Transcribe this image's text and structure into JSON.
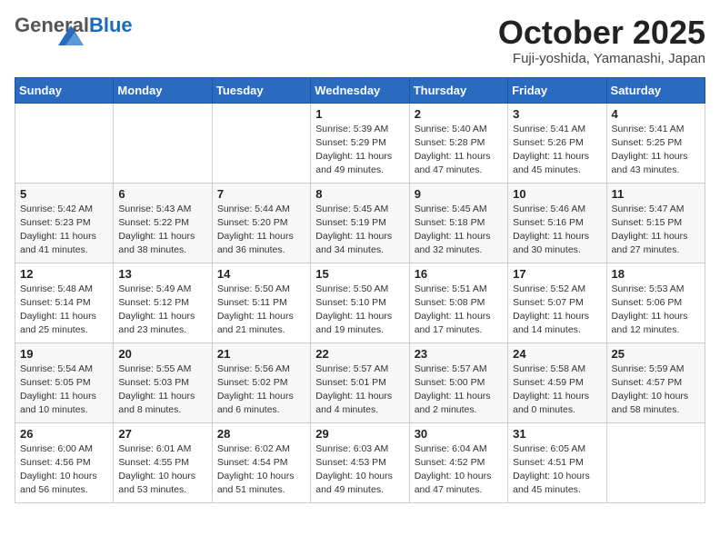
{
  "header": {
    "logo_general": "General",
    "logo_blue": "Blue",
    "month_title": "October 2025",
    "location": "Fuji-yoshida, Yamanashi, Japan"
  },
  "calendar": {
    "days_of_week": [
      "Sunday",
      "Monday",
      "Tuesday",
      "Wednesday",
      "Thursday",
      "Friday",
      "Saturday"
    ],
    "weeks": [
      [
        {
          "day": "",
          "info": ""
        },
        {
          "day": "",
          "info": ""
        },
        {
          "day": "",
          "info": ""
        },
        {
          "day": "1",
          "info": "Sunrise: 5:39 AM\nSunset: 5:29 PM\nDaylight: 11 hours\nand 49 minutes."
        },
        {
          "day": "2",
          "info": "Sunrise: 5:40 AM\nSunset: 5:28 PM\nDaylight: 11 hours\nand 47 minutes."
        },
        {
          "day": "3",
          "info": "Sunrise: 5:41 AM\nSunset: 5:26 PM\nDaylight: 11 hours\nand 45 minutes."
        },
        {
          "day": "4",
          "info": "Sunrise: 5:41 AM\nSunset: 5:25 PM\nDaylight: 11 hours\nand 43 minutes."
        }
      ],
      [
        {
          "day": "5",
          "info": "Sunrise: 5:42 AM\nSunset: 5:23 PM\nDaylight: 11 hours\nand 41 minutes."
        },
        {
          "day": "6",
          "info": "Sunrise: 5:43 AM\nSunset: 5:22 PM\nDaylight: 11 hours\nand 38 minutes."
        },
        {
          "day": "7",
          "info": "Sunrise: 5:44 AM\nSunset: 5:20 PM\nDaylight: 11 hours\nand 36 minutes."
        },
        {
          "day": "8",
          "info": "Sunrise: 5:45 AM\nSunset: 5:19 PM\nDaylight: 11 hours\nand 34 minutes."
        },
        {
          "day": "9",
          "info": "Sunrise: 5:45 AM\nSunset: 5:18 PM\nDaylight: 11 hours\nand 32 minutes."
        },
        {
          "day": "10",
          "info": "Sunrise: 5:46 AM\nSunset: 5:16 PM\nDaylight: 11 hours\nand 30 minutes."
        },
        {
          "day": "11",
          "info": "Sunrise: 5:47 AM\nSunset: 5:15 PM\nDaylight: 11 hours\nand 27 minutes."
        }
      ],
      [
        {
          "day": "12",
          "info": "Sunrise: 5:48 AM\nSunset: 5:14 PM\nDaylight: 11 hours\nand 25 minutes."
        },
        {
          "day": "13",
          "info": "Sunrise: 5:49 AM\nSunset: 5:12 PM\nDaylight: 11 hours\nand 23 minutes."
        },
        {
          "day": "14",
          "info": "Sunrise: 5:50 AM\nSunset: 5:11 PM\nDaylight: 11 hours\nand 21 minutes."
        },
        {
          "day": "15",
          "info": "Sunrise: 5:50 AM\nSunset: 5:10 PM\nDaylight: 11 hours\nand 19 minutes."
        },
        {
          "day": "16",
          "info": "Sunrise: 5:51 AM\nSunset: 5:08 PM\nDaylight: 11 hours\nand 17 minutes."
        },
        {
          "day": "17",
          "info": "Sunrise: 5:52 AM\nSunset: 5:07 PM\nDaylight: 11 hours\nand 14 minutes."
        },
        {
          "day": "18",
          "info": "Sunrise: 5:53 AM\nSunset: 5:06 PM\nDaylight: 11 hours\nand 12 minutes."
        }
      ],
      [
        {
          "day": "19",
          "info": "Sunrise: 5:54 AM\nSunset: 5:05 PM\nDaylight: 11 hours\nand 10 minutes."
        },
        {
          "day": "20",
          "info": "Sunrise: 5:55 AM\nSunset: 5:03 PM\nDaylight: 11 hours\nand 8 minutes."
        },
        {
          "day": "21",
          "info": "Sunrise: 5:56 AM\nSunset: 5:02 PM\nDaylight: 11 hours\nand 6 minutes."
        },
        {
          "day": "22",
          "info": "Sunrise: 5:57 AM\nSunset: 5:01 PM\nDaylight: 11 hours\nand 4 minutes."
        },
        {
          "day": "23",
          "info": "Sunrise: 5:57 AM\nSunset: 5:00 PM\nDaylight: 11 hours\nand 2 minutes."
        },
        {
          "day": "24",
          "info": "Sunrise: 5:58 AM\nSunset: 4:59 PM\nDaylight: 11 hours\nand 0 minutes."
        },
        {
          "day": "25",
          "info": "Sunrise: 5:59 AM\nSunset: 4:57 PM\nDaylight: 10 hours\nand 58 minutes."
        }
      ],
      [
        {
          "day": "26",
          "info": "Sunrise: 6:00 AM\nSunset: 4:56 PM\nDaylight: 10 hours\nand 56 minutes."
        },
        {
          "day": "27",
          "info": "Sunrise: 6:01 AM\nSunset: 4:55 PM\nDaylight: 10 hours\nand 53 minutes."
        },
        {
          "day": "28",
          "info": "Sunrise: 6:02 AM\nSunset: 4:54 PM\nDaylight: 10 hours\nand 51 minutes."
        },
        {
          "day": "29",
          "info": "Sunrise: 6:03 AM\nSunset: 4:53 PM\nDaylight: 10 hours\nand 49 minutes."
        },
        {
          "day": "30",
          "info": "Sunrise: 6:04 AM\nSunset: 4:52 PM\nDaylight: 10 hours\nand 47 minutes."
        },
        {
          "day": "31",
          "info": "Sunrise: 6:05 AM\nSunset: 4:51 PM\nDaylight: 10 hours\nand 45 minutes."
        },
        {
          "day": "",
          "info": ""
        }
      ]
    ]
  }
}
